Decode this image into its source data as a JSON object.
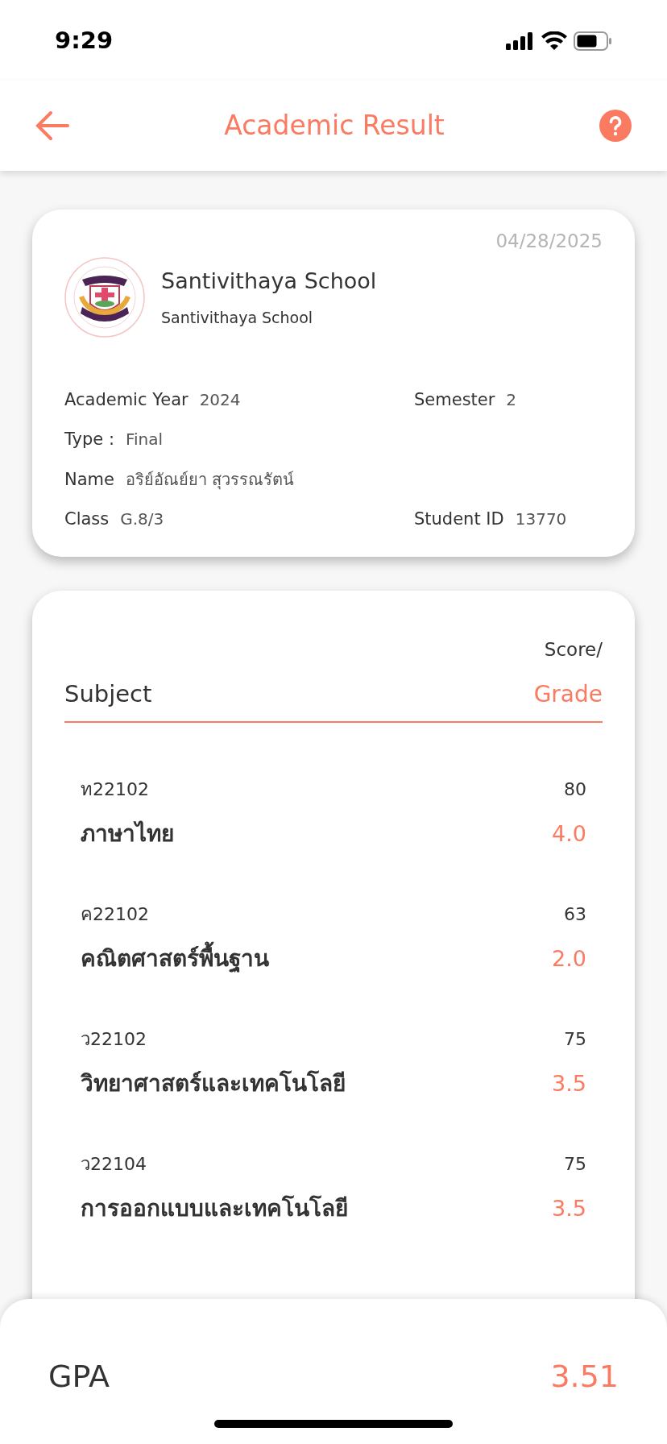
{
  "status_bar": {
    "time": "9:29"
  },
  "header": {
    "title": "Academic Result"
  },
  "info_card": {
    "date": "04/28/2025",
    "school_name": "Santivithaya School",
    "school_subtitle": "Santivithaya School",
    "field_rows": [
      [
        {
          "label": "Academic Year",
          "value": "2024"
        },
        {
          "label": "Semester",
          "value": "2"
        }
      ],
      [
        {
          "label": "Type :",
          "value": "Final"
        }
      ],
      [
        {
          "label": "Name",
          "value": "อริย์อัณย์ยา สุวรรณรัตน์"
        }
      ],
      [
        {
          "label": "Class",
          "value": "G.8/3"
        },
        {
          "label": "Student ID",
          "value": "13770"
        }
      ]
    ]
  },
  "results": {
    "subject_heading": "Subject",
    "score_heading": "Score/",
    "grade_heading": "Grade",
    "rows": [
      {
        "code": "ท22102",
        "subject": "ภาษาไทย",
        "score": "80",
        "grade": "4.0"
      },
      {
        "code": "ค22102",
        "subject": "คณิตศาสตร์พื้นฐาน",
        "score": "63",
        "grade": "2.0"
      },
      {
        "code": "ว22102",
        "subject": "วิทยาศาสตร์และเทคโนโลยี",
        "score": "75",
        "grade": "3.5"
      },
      {
        "code": "ว22104",
        "subject": "การออกแบบและเทคโนโลยี",
        "score": "75",
        "grade": "3.5"
      }
    ]
  },
  "gpa": {
    "label": "GPA",
    "value": "3.51"
  }
}
